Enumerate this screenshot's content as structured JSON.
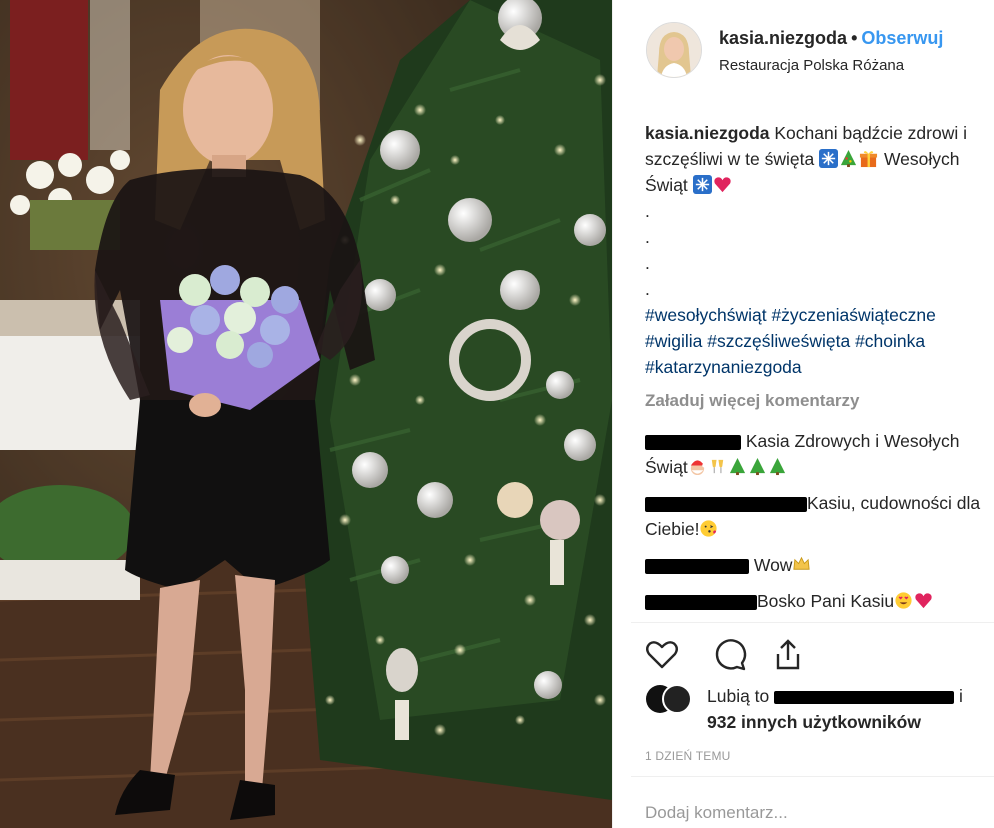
{
  "post": {
    "username": "kasia.niezgoda",
    "separator": "•",
    "follow_label": "Obserwuj",
    "location": "Restauracja Polska Różana"
  },
  "caption": {
    "username": "kasia.niezgoda",
    "text_1": "Kochani bądźcie zdrowi i szczęśliwi w te święta",
    "text_2": "Wesołych Świąt",
    "dots": [
      ".",
      ".",
      ".",
      "."
    ],
    "hashtags": "#wesołychświąt #życzeniaświąteczne #wigilia #szczęśliweświęta #choinka #katarzynaniezgoda"
  },
  "load_more_label": "Załaduj więcej komentarzy",
  "comments": [
    {
      "text": "Kasia Zdrowych i Wesołych Świąt"
    },
    {
      "text": "Kasiu, cudowności dla Ciebie!"
    },
    {
      "text": "Wow"
    },
    {
      "text": "Bosko Pani Kasiu"
    }
  ],
  "actions": {
    "like_icon": "heart-outline-icon",
    "comment_icon": "comment-bubble-icon",
    "share_icon": "share-upload-icon"
  },
  "likes": {
    "prefix": "Lubią to",
    "suffix": "i",
    "others": "932 innych użytkowników"
  },
  "time_ago": "1 DZIEŃ TEMU",
  "add_comment_placeholder": "Dodaj komentarz..."
}
